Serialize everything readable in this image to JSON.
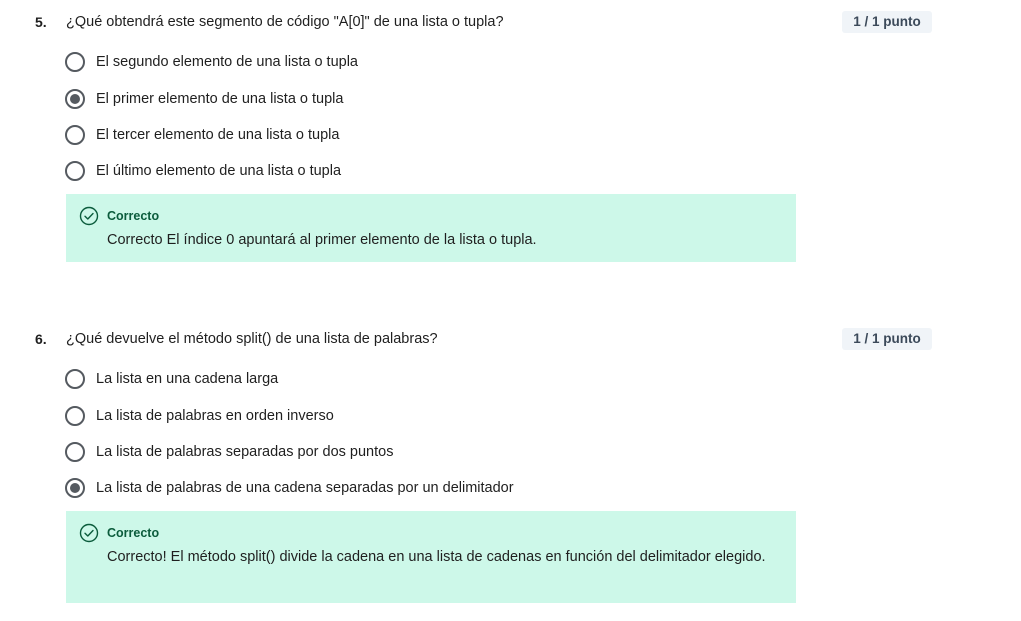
{
  "questions": [
    {
      "number": "5.",
      "text": "¿Qué obtendrá este segmento de código \"A[0]\" de una lista o tupla?",
      "score": "1 / 1 punto",
      "options": [
        {
          "label": "El segundo elemento de una lista o tupla",
          "checked": false
        },
        {
          "label": "El primer elemento de una lista o tupla",
          "checked": true
        },
        {
          "label": "El tercer elemento de una lista o tupla",
          "checked": false
        },
        {
          "label": "El último elemento de una lista o tupla",
          "checked": false
        }
      ],
      "feedback": {
        "title": "Correcto",
        "text": "Correcto El índice 0 apuntará al primer elemento de la lista o tupla."
      }
    },
    {
      "number": "6.",
      "text": "¿Qué devuelve el método split() de una lista de palabras?",
      "score": "1 / 1 punto",
      "options": [
        {
          "label": "La lista en una cadena larga",
          "checked": false
        },
        {
          "label": "La lista de palabras en orden inverso",
          "checked": false
        },
        {
          "label": "La lista de palabras separadas por dos puntos",
          "checked": false
        },
        {
          "label": "La lista de palabras de una cadena separadas por un delimitador",
          "checked": true
        }
      ],
      "feedback": {
        "title": "Correcto",
        "text": "Correcto! El método split() divide la cadena en una lista de cadenas en función del delimitador elegido."
      }
    }
  ],
  "colors": {
    "feedback_bg": "#cdf8e9",
    "feedback_title": "#0b5c3c",
    "score_bg": "#f0f4f8"
  }
}
